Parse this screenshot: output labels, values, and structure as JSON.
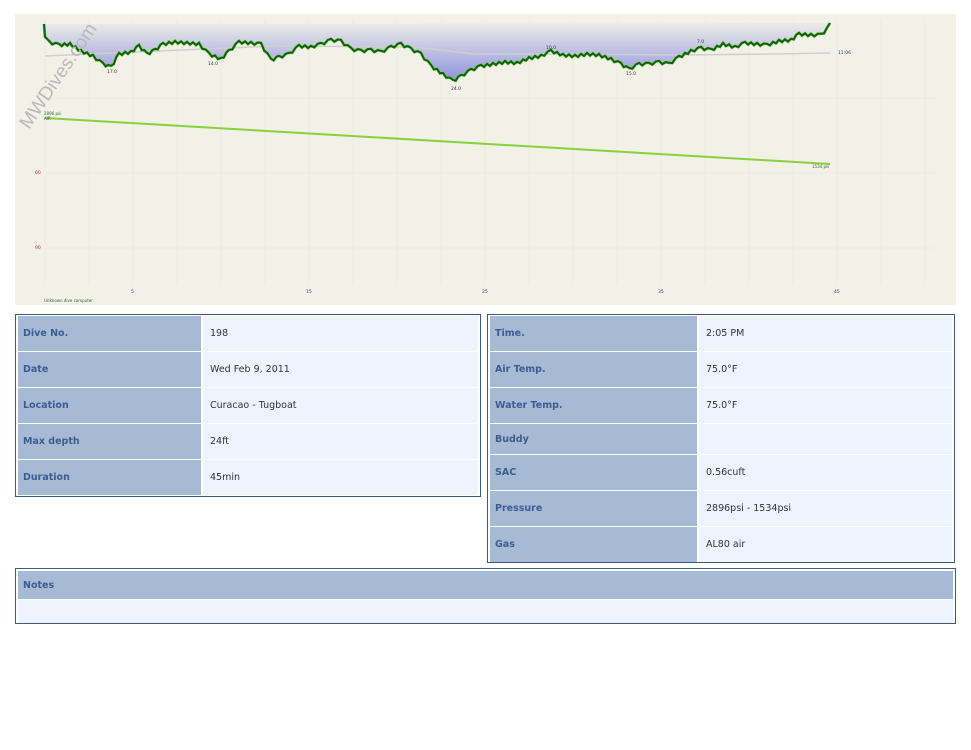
{
  "profile": {
    "watermark": "MWDives.com",
    "x_ticks": [
      "5",
      "15",
      "25",
      "35",
      "45"
    ],
    "y_ticks": [
      "60",
      "90"
    ],
    "depth_marks": [
      "17.0",
      "14.0",
      "24.0",
      "15.0",
      "10.0",
      "7.0"
    ],
    "temp_label": "11:06",
    "pressure_start": "2896 psi",
    "pressure_start_gas": "AIR",
    "pressure_end": "1534 psi",
    "computer_label": "Unknown dive computer",
    "colors": {
      "background": "#f2f1e7",
      "depth_line_dark": "#0e5e1a",
      "depth_line_light": "#8fd64a",
      "depth_fill": "#9aa0e6",
      "pressure_line": "#8ccf3c",
      "temp_line": "#c9c9c9"
    }
  },
  "dive_info": {
    "dive_no_label": "Dive No.",
    "dive_no": "198",
    "date_label": "Date",
    "date": "Wed Feb 9, 2011",
    "location_label": "Location",
    "location": "Curacao - Tugboat",
    "max_depth_label": "Max depth",
    "max_depth": "24ft",
    "duration_label": "Duration",
    "duration": "45min"
  },
  "dive_details": {
    "time_label": "Time.",
    "time": "2:05 PM",
    "air_temp_label": "Air Temp.",
    "air_temp": "75.0°F",
    "water_temp_label": "Water Temp.",
    "water_temp": "75.0°F",
    "buddy_label": "Buddy",
    "buddy": "",
    "sac_label": "SAC",
    "sac": "0.56cuft",
    "pressure_label": "Pressure",
    "pressure": "2896psi - 1534psi",
    "gas_label": "Gas",
    "gas": "AL80 air"
  },
  "notes": {
    "label": "Notes",
    "text": ""
  }
}
